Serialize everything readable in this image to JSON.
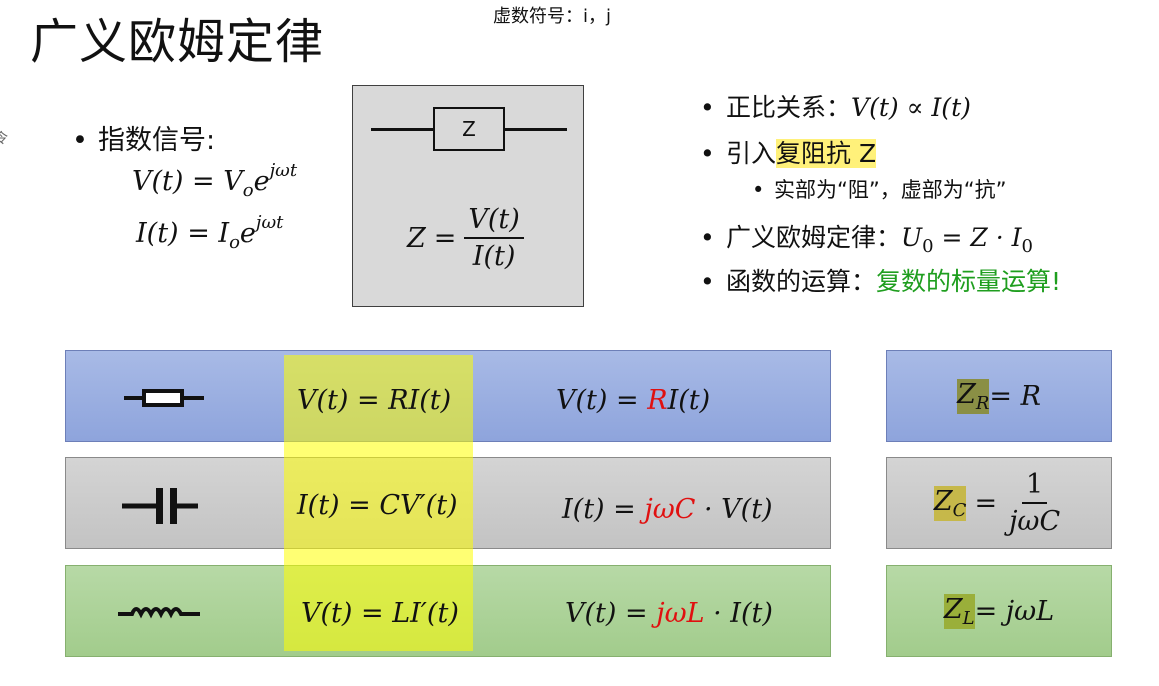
{
  "title": "广义欧姆定律",
  "note": "虚数符号：i，j",
  "side_mark": "令",
  "exp_signal": {
    "label": "指数信号:",
    "v_left": "V(t)",
    "eq": "=",
    "v_base": "V",
    "v_sub": "o",
    "e": "e",
    "sup": "jωt",
    "i_left": "I(t)",
    "i_base": "I",
    "i_sub": "o"
  },
  "zbox": {
    "element_label": "Z",
    "z": "Z",
    "eq": "=",
    "num": "V(t)",
    "den": "I(t)"
  },
  "bullets": {
    "b1_text": "正比关系：",
    "b1_math": "V(t) ∝ I(t)",
    "b2_text": "引入",
    "b2_highlight": "复阻抗 Z",
    "b2_sub": "实部为“阻”，虚部为“抗”",
    "b3_text": "广义欧姆定律：",
    "b3_u": "U",
    "b3_z": "Z · I",
    "b3_sub": "0",
    "b3_eq": "=",
    "b4_text": "函数的运算：",
    "b4_green": "复数的标量运算!"
  },
  "rows": {
    "r": {
      "formula": "V(t) = RI(t)",
      "rhs_pre": "V(t) = ",
      "rhs_red": "R",
      "rhs_post": "I(t)",
      "z": "Z",
      "z_sub": "R",
      "z_rest": " = R"
    },
    "c": {
      "formula": "I(t) = CV′(t)",
      "rhs_pre": "I(t) = ",
      "rhs_red": "jωC",
      "rhs_post": " · V(t)",
      "z": "Z",
      "z_sub": "C",
      "z_eq": "=",
      "z_num": "1",
      "z_den": "jωC"
    },
    "l": {
      "formula": "V(t) = LI′(t)",
      "rhs_pre": "V(t) = ",
      "rhs_red": "jωL",
      "rhs_post": " · I(t)",
      "z": "Z",
      "z_sub": "L",
      "z_rest": " = jωL"
    }
  },
  "colors": {
    "highlight": "#fff17a",
    "green_text": "#1f9e1f",
    "red_text": "#e01010",
    "band_blue": "#9aaee1",
    "band_gray": "#cbcbcb",
    "band_green": "#acd29a"
  }
}
